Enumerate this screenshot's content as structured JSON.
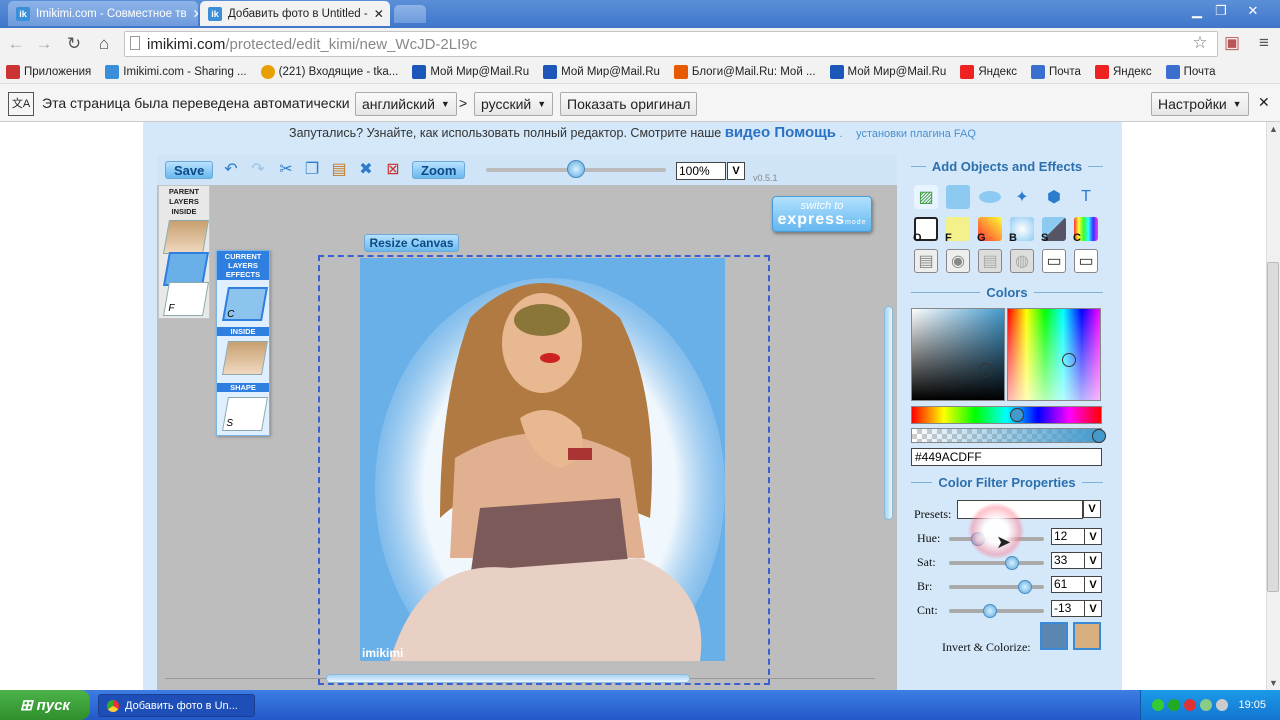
{
  "browser": {
    "tabs": [
      {
        "title": "Imikimi.com - Совместное тв",
        "active": false
      },
      {
        "title": "Добавить фото в Untitled -",
        "active": true
      }
    ],
    "url_host": "imikimi.com",
    "url_path": "/protected/edit_kimi/new_WcJD-2LI9c",
    "bookmarks": [
      {
        "label": "Приложения",
        "color": "#c33"
      },
      {
        "label": "Imikimi.com - Sharing ...",
        "color": "#3b8fd8"
      },
      {
        "label": "(221) Входящие - tka...",
        "color": "#e8a000"
      },
      {
        "label": "Мой Мир@Mail.Ru",
        "color": "#1b56b8"
      },
      {
        "label": "Мой Мир@Mail.Ru",
        "color": "#1b56b8"
      },
      {
        "label": "Блоги@Mail.Ru: Мой ...",
        "color": "#e85a00"
      },
      {
        "label": "Мой Мир@Mail.Ru",
        "color": "#1b56b8"
      },
      {
        "label": "Яндекс",
        "color": "#e22"
      },
      {
        "label": "Почта",
        "color": "#3a6fd0"
      },
      {
        "label": "Яндекс",
        "color": "#e22"
      },
      {
        "label": "Почта",
        "color": "#3a6fd0"
      }
    ],
    "translate": {
      "message": "Эта страница была переведена автоматически",
      "from": "английский",
      "arrow": ">",
      "to": "русский",
      "show_original": "Показать оригинал",
      "settings": "Настройки"
    }
  },
  "page": {
    "note_text": "Запутались? Узнайте, как использовать полный редактор. Смотрите наше",
    "note_link": "видео Помощь",
    "note_dot": ".",
    "note_plugin": "установки плагина FAQ",
    "toolbar": {
      "save": "Save",
      "zoom": "Zoom",
      "zoom_value": "100%",
      "v": "V",
      "version": "v0.5.1"
    },
    "layers": {
      "parent_title": "PARENT LAYERS INSIDE",
      "current_title": "CURRENT LAYERS EFFECTS",
      "inside": "INSIDE",
      "shape": "SHAPE",
      "f_label": "F",
      "c_label": "C",
      "s_label": "S"
    },
    "switch_to": "switch to",
    "express": "express",
    "mode": "mode",
    "resize_canvas": "Resize Canvas",
    "watermark": "imikimi"
  },
  "panel": {
    "add_objects": "Add Objects and Effects",
    "row2_labels": [
      "O",
      "F",
      "G",
      "B",
      "S",
      "C"
    ],
    "colors": "Colors",
    "hex": "#449ACDFF",
    "filter_title": "Color Filter Properties",
    "presets": "Presets:",
    "sliders": [
      {
        "label": "Hue:",
        "value": "12",
        "fraction": 0.3
      },
      {
        "label": "Sat:",
        "value": "33",
        "fraction": 0.66
      },
      {
        "label": "Br:",
        "value": "61",
        "fraction": 0.8
      },
      {
        "label": "Cnt:",
        "value": "-13",
        "fraction": 0.43
      }
    ],
    "invert": "Invert & Colorize:"
  },
  "taskbar": {
    "start": "пуск",
    "item": "Добавить фото в Un...",
    "time": "19:05"
  },
  "colors": {
    "accent": "#2c6fad",
    "picked": "#449acd"
  }
}
